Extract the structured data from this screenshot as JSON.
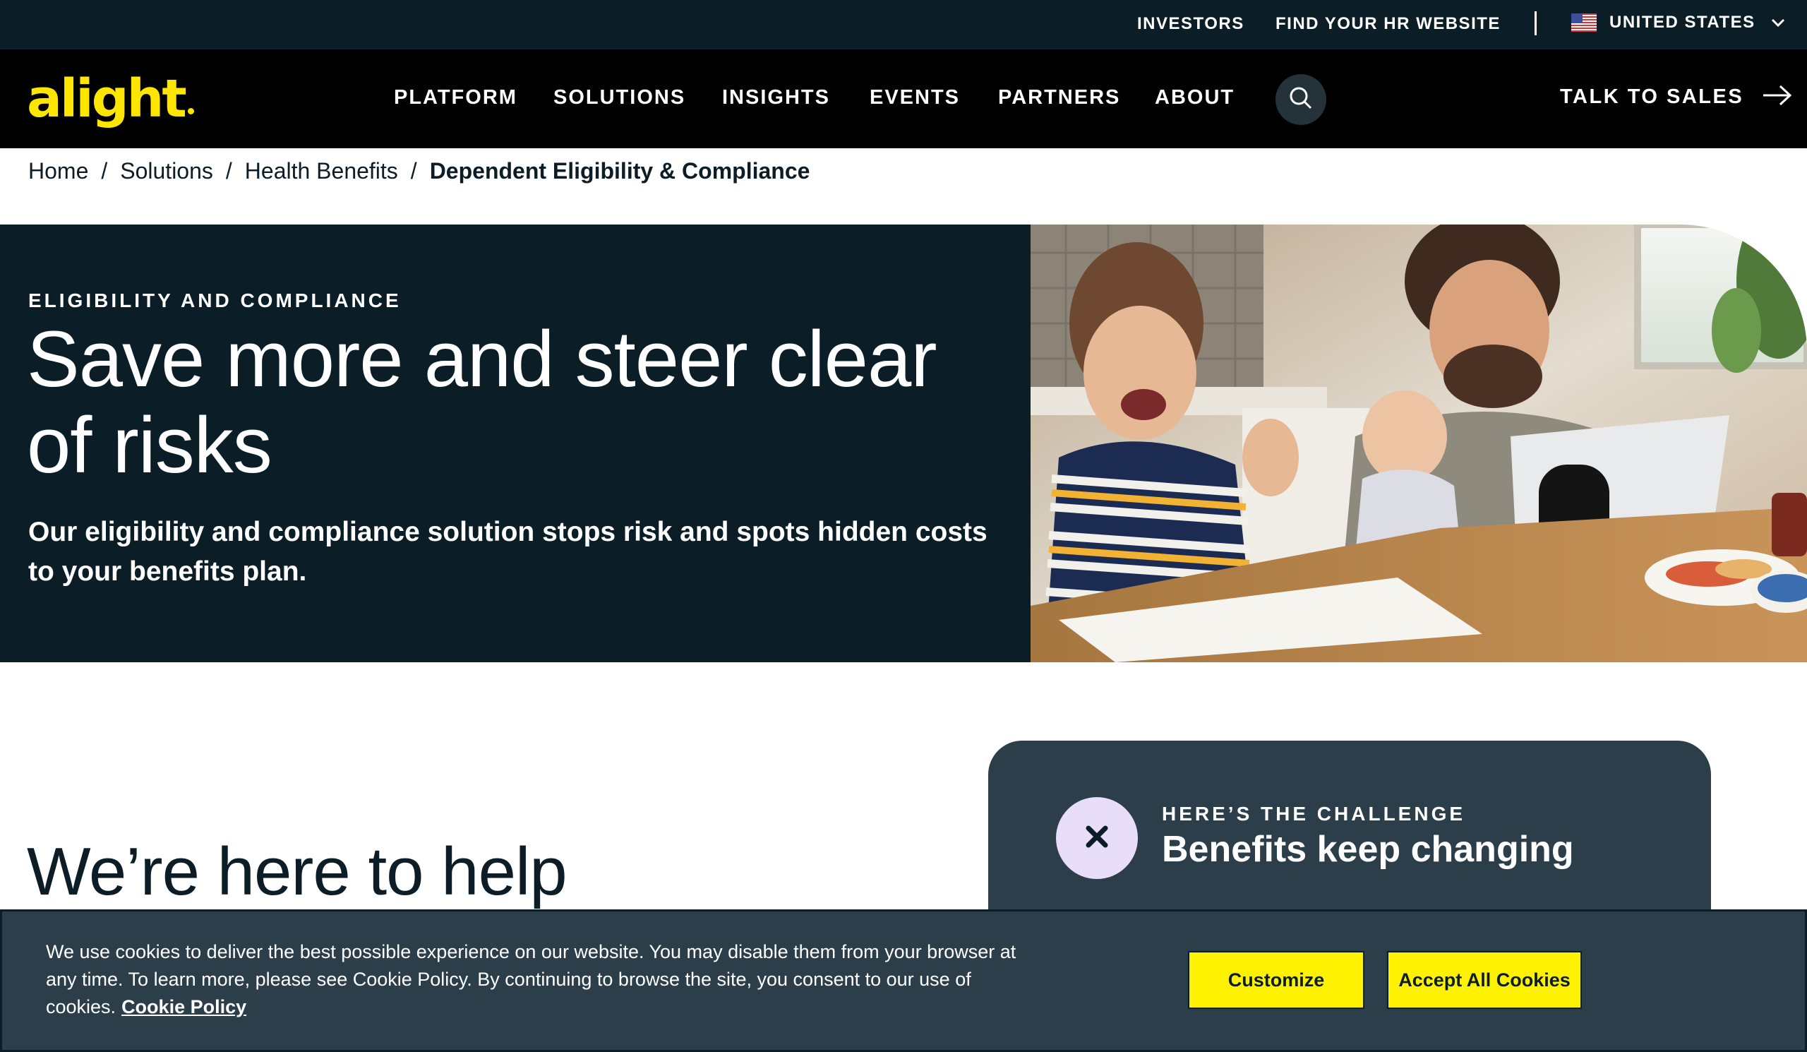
{
  "utility": {
    "investors": "INVESTORS",
    "find_hr": "FIND YOUR HR WEBSITE",
    "country": "UNITED STATES",
    "flag_icon": "us-flag-icon"
  },
  "nav": {
    "logo": "alight",
    "items": [
      "PLATFORM",
      "SOLUTIONS",
      "INSIGHTS",
      "EVENTS",
      "PARTNERS",
      "ABOUT"
    ],
    "talk_to_sales": "TALK TO SALES"
  },
  "breadcrumb": {
    "items": [
      "Home",
      "Solutions",
      "Health Benefits"
    ],
    "separator": "/",
    "current": "Dependent Eligibility & Compliance"
  },
  "hero": {
    "eyebrow": "ELIGIBILITY AND COMPLIANCE",
    "title": "Save more and steer clear of risks",
    "subtitle": "Our eligibility and compliance solution stops risk and spots hidden costs to your benefits plan."
  },
  "help": {
    "heading": "We’re here to help"
  },
  "challenge": {
    "eyebrow": "HERE’S THE CHALLENGE",
    "title": "Benefits keep changing"
  },
  "cookie": {
    "text": "We use cookies to deliver the best possible experience on our website. You may disable them from your browser at any time. To learn more, please see Cookie Policy. By continuing to browse the site, you consent to our use of cookies.",
    "link": "Cookie Policy",
    "customize": "Customize",
    "accept": "Accept All Cookies"
  },
  "colors": {
    "brand_yellow": "#ffe600",
    "dark_navy": "#0b1e28",
    "card_slate": "#2c3e4a",
    "button_yellow": "#fff200"
  }
}
